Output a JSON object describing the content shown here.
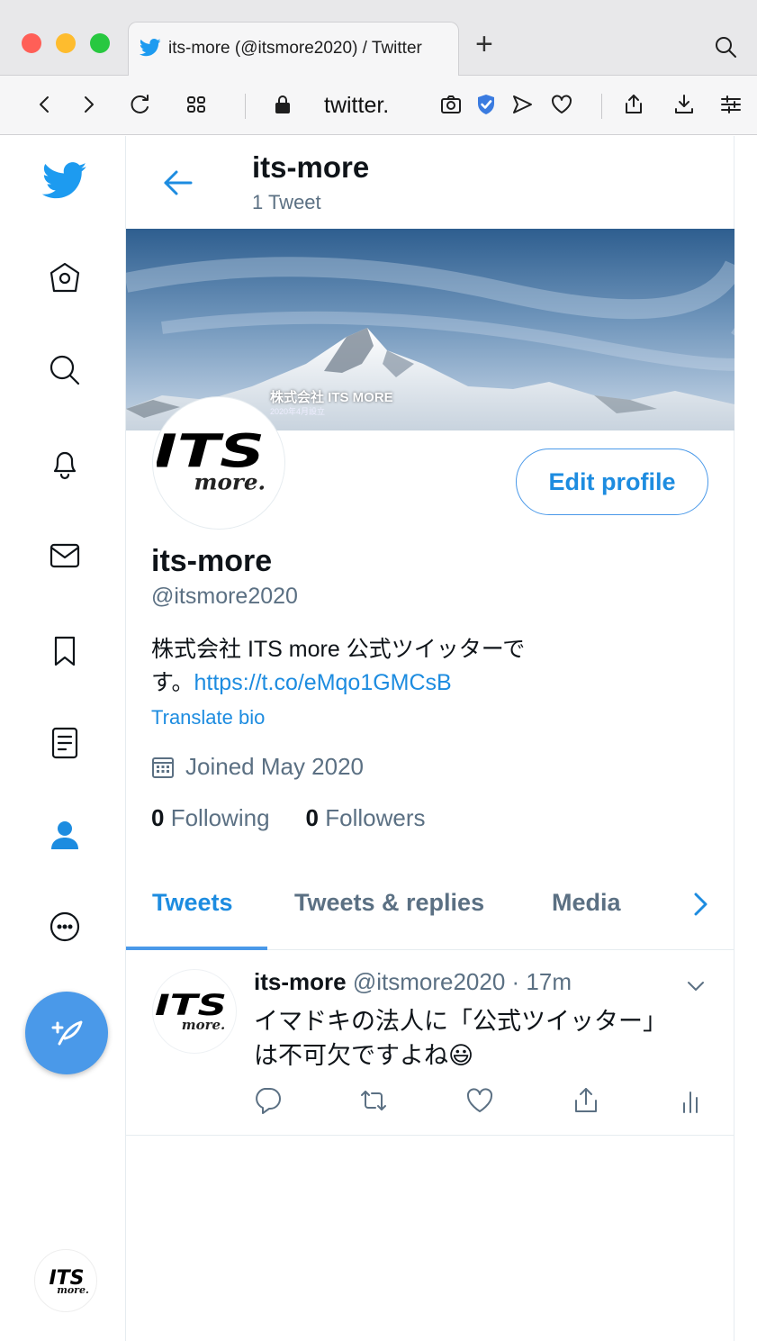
{
  "browser": {
    "tab_title": "its-more (@itsmore2020) / Twitter",
    "new_tab_label": "+",
    "url": "twitter.",
    "colors": {
      "close": "#ff5f57",
      "minimize": "#febc2e",
      "zoom": "#28c840",
      "accent": "#1d8ce0"
    }
  },
  "header": {
    "name": "its-more",
    "tweet_count": "1 Tweet"
  },
  "banner": {
    "caption": "株式会社 ITS MORE",
    "subcaption": "2020年4月設立"
  },
  "logo": {
    "top": "ITS",
    "bottom": "more."
  },
  "profile": {
    "edit_label": "Edit profile",
    "name": "its-more",
    "handle": "@itsmore2020",
    "bio_line1": "株式会社 ITS more 公式ツイッターで",
    "bio_line2": "す。",
    "bio_link": "https://t.co/eMqo1GMCsB",
    "translate": "Translate bio",
    "joined": "Joined May 2020",
    "following_count": "0",
    "following_label": "Following",
    "followers_count": "0",
    "followers_label": "Followers"
  },
  "tabs": [
    {
      "label": "Tweets",
      "active": true
    },
    {
      "label": "Tweets & replies",
      "active": false
    },
    {
      "label": "Media",
      "active": false
    }
  ],
  "tweet": {
    "name": "its-more",
    "handle": "@itsmore2020",
    "time": "· 17m",
    "text_line1": "イマドキの法人に「公式ツイッター」",
    "text_line2": "は不可欠ですよね😃"
  }
}
